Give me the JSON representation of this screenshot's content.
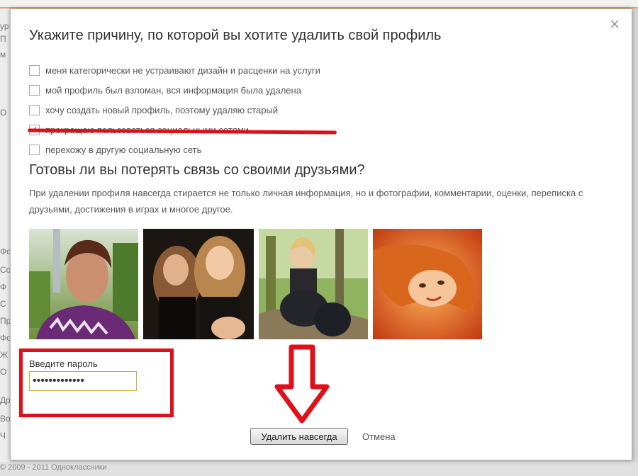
{
  "modal": {
    "title": "Укажите причину, по которой вы хотите удалить свой профиль",
    "close_glyph": "×",
    "reasons": [
      {
        "label": "меня категорически не устраивают дизайн и расценки на услуги",
        "checked": false
      },
      {
        "label": "мой профиль был взломан, вся информация была удалена",
        "checked": false
      },
      {
        "label": "хочу создать новый профиль, поэтому удаляю старый",
        "checked": false
      },
      {
        "label": "прекращаю пользоваться социальными сетями",
        "checked": true
      },
      {
        "label": "перехожу в другую социальную сеть",
        "checked": false
      }
    ],
    "subtitle": "Готовы ли вы потерять связь со своими друзьями?",
    "info_text": "При удалении профиля навсегда стирается не только личная информация, но и фотографии, комментарии, оценки, переписка с друзьями, достижения в играх и многое другое.",
    "photos": [
      "friend-photo-1",
      "friend-photo-2",
      "friend-photo-3",
      "friend-photo-4"
    ],
    "password": {
      "label": "Введите пароль",
      "value": "•••••••••••••"
    },
    "delete_button": "Удалить навсегда",
    "cancel_link": "Отмена"
  },
  "annotations": {
    "highlight_color": "#e0101a"
  },
  "background": {
    "left_fragments": [
      "ур",
      "П",
      "м",
      "О",
      "Фо",
      "Сс",
      "Ф",
      "С",
      "Пр",
      "Фо",
      "Ж",
      "О",
      "Др",
      "Во",
      "Ч"
    ],
    "footer_text": "© 2009 - 2011 Одноклассники"
  }
}
